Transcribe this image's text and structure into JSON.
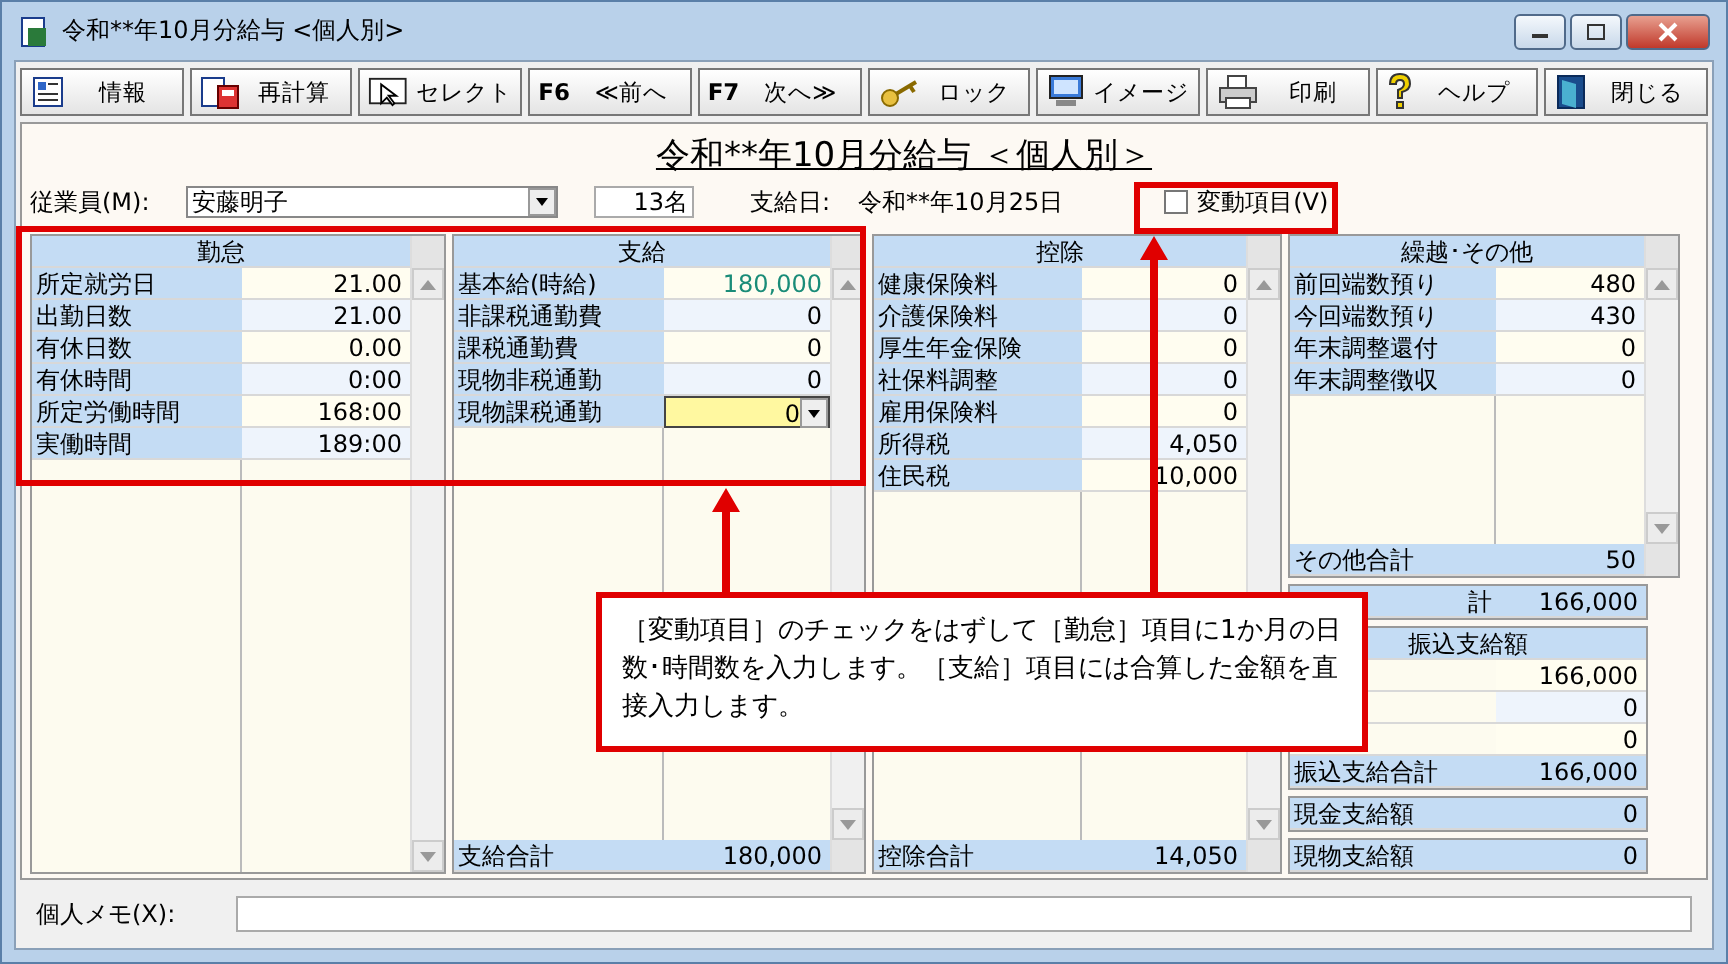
{
  "window": {
    "title": "令和**年10月分給与 <個人別>"
  },
  "toolbar": [
    {
      "kind": "info",
      "label": "情報"
    },
    {
      "kind": "recalc",
      "label": "再計算"
    },
    {
      "kind": "select",
      "label": "セレクト"
    },
    {
      "kind": "prev",
      "key": "F6",
      "label": "≪前へ"
    },
    {
      "kind": "next",
      "key": "F7",
      "label": "次へ≫"
    },
    {
      "kind": "lock",
      "label": "ロック"
    },
    {
      "kind": "image",
      "label": "イメージ"
    },
    {
      "kind": "print",
      "label": "印刷"
    },
    {
      "kind": "help",
      "label": "ヘルプ"
    },
    {
      "kind": "close",
      "label": "閉じる"
    }
  ],
  "heading": "令和**年10月分給与 ＜個人別＞",
  "employee": {
    "label": "従業員(M):",
    "value": "安藤明子",
    "count": "13名",
    "pay_date_label": "支給日:",
    "pay_date": "令和**年10月25日",
    "variable_items": {
      "label": "変動項目(V)",
      "checked": false
    }
  },
  "panels": [
    {
      "title": "勤怠",
      "rows": [
        {
          "label": "所定就労日",
          "value": "21.00"
        },
        {
          "label": "出勤日数",
          "value": "21.00"
        },
        {
          "label": "有休日数",
          "value": "0.00"
        },
        {
          "label": "有休時間",
          "value": "0:00"
        },
        {
          "label": "所定労働時間",
          "value": "168:00"
        },
        {
          "label": "実働時間",
          "value": "189:00"
        }
      ]
    },
    {
      "title": "支給",
      "rows": [
        {
          "label": "基本給(時給)",
          "value": "180,000",
          "color": "#1a8c78",
          "editing": false
        },
        {
          "label": "非課税通勤費",
          "value": "0",
          "editing": false
        },
        {
          "label": "課税通勤費",
          "value": "0",
          "editing": false
        },
        {
          "label": "現物非税通勤",
          "value": "0",
          "editing": false
        },
        {
          "label": "現物課税通勤",
          "value": "0",
          "editing": true
        }
      ],
      "footer": {
        "label": "支給合計",
        "value": "180,000"
      }
    },
    {
      "title": "控除",
      "rows": [
        {
          "label": "健康保険料",
          "value": "0"
        },
        {
          "label": "介護保険料",
          "value": "0"
        },
        {
          "label": "厚生年金保険",
          "value": "0"
        },
        {
          "label": "社保料調整",
          "value": "0"
        },
        {
          "label": "雇用保険料",
          "value": "0"
        },
        {
          "label": "所得税",
          "value": "4,050"
        },
        {
          "label": "住民税",
          "value": "10,000"
        }
      ],
      "footer": {
        "label": "控除合計",
        "value": "14,050"
      }
    },
    {
      "title": "繰越･その他",
      "rows": [
        {
          "label": "前回端数預り",
          "value": "480"
        },
        {
          "label": "今回端数預り",
          "value": "430"
        },
        {
          "label": "年末調整還付",
          "value": "0"
        },
        {
          "label": "年末調整徴収",
          "value": "0"
        }
      ],
      "footer": {
        "label": "その他合計",
        "value": "50"
      }
    }
  ],
  "net_total": {
    "label": "計",
    "value": "166,000"
  },
  "transfer": {
    "title": "振込支給額",
    "rows": [
      {
        "value": "166,000"
      },
      {
        "value": "0"
      },
      {
        "value": "0"
      }
    ],
    "total": {
      "label": "振込支給合計",
      "value": "166,000"
    }
  },
  "payouts": [
    {
      "label": "現金支給額",
      "value": "0"
    },
    {
      "label": "現物支給額",
      "value": "0"
    }
  ],
  "memo": {
    "label": "個人メモ(X):"
  },
  "callout": "［変動項目］のチェックをはずして［勤怠］項目に1か月の日数･時間数を入力します。［支給］項目には合算した金額を直接入力します。"
}
